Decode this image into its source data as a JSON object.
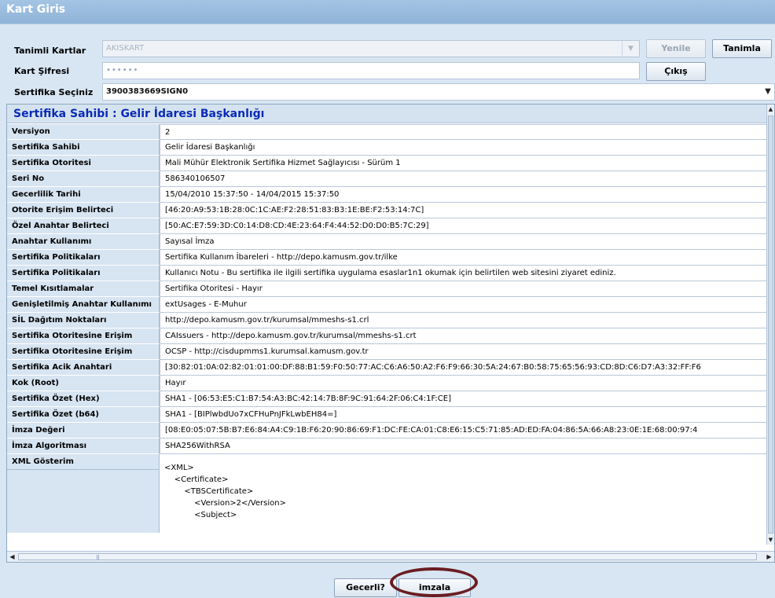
{
  "window": {
    "title": "Kart Giris"
  },
  "form": {
    "card_label": "Tanimli Kartlar",
    "card_value": "AKISKART",
    "refresh_label": "Yenile",
    "define_label": "Tanimla",
    "pin_label": "Kart Şifresi",
    "pin_value": "••••••",
    "exit_label": "Çıkış",
    "cert_label": "Sertifika Seçiniz",
    "cert_value": "3900383669SIGN0"
  },
  "panel": {
    "title": "Sertifika Sahibi : Gelir İdaresi Başkanlığı",
    "rows": [
      {
        "key": "Versiyon",
        "value": "2"
      },
      {
        "key": "Sertifika Sahibi",
        "value": "Gelir İdaresi Başkanlığı"
      },
      {
        "key": "Sertifika Otoritesi",
        "value": "Mali Mühür Elektronik Sertifika Hizmet Sağlayıcısı - Sürüm 1"
      },
      {
        "key": "Seri No",
        "value": "586340106507"
      },
      {
        "key": "Gecerlilik Tarihi",
        "value": "15/04/2010 15:37:50 - 14/04/2015 15:37:50"
      },
      {
        "key": "Otorite Erişim Belirteci",
        "value": "[46:20:A9:53:1B:28:0C:1C:AE:F2:28:51:83:B3:1E:BE:F2:53:14:7C]"
      },
      {
        "key": "Özel Anahtar Belirteci",
        "value": "[50:AC:E7:59:3D:C0:14:D8:CD:4E:23:64:F4:44:52:D0:D0:B5:7C:29]"
      },
      {
        "key": "Anahtar Kullanımı",
        "value": "Sayısal İmza"
      },
      {
        "key": "Sertifika Politikaları",
        "value": "Sertifika Kullanım İbareleri - http://depo.kamusm.gov.tr/ilke"
      },
      {
        "key": "Sertifika Politikaları",
        "value": "Kullanıcı Notu - Bu sertifika ile ilgili sertifika uygulama esaslar1n1 okumak için belirtilen web sitesini ziyaret ediniz."
      },
      {
        "key": "Temel Kısıtlamalar",
        "value": "Sertifika Otoritesi - Hayır"
      },
      {
        "key": "Genişletilmiş Anahtar Kullanımı",
        "value": "extUsages - E-Muhur"
      },
      {
        "key": "SİL Dağıtım Noktaları",
        "value": " http://depo.kamusm.gov.tr/kurumsal/mmeshs-s1.crl"
      },
      {
        "key": "Sertifika Otoritesine Erişim",
        "value": "CAIssuers - http://depo.kamusm.gov.tr/kurumsal/mmeshs-s1.crt"
      },
      {
        "key": "Sertifika Otoritesine Erişim",
        "value": "OCSP - http://cisdupmms1.kurumsal.kamusm.gov.tr"
      },
      {
        "key": "Sertifika Acik Anahtari",
        "value": "[30:82:01:0A:02:82:01:01:00:DF:88:B1:59:F0:50:77:AC:C6:A6:50:A2:F6:F9:66:30:5A:24:67:B0:58:75:65:56:93:CD:8D:C6:D7:A3:32:FF:F6"
      },
      {
        "key": "Kok (Root)",
        "value": "Hayır"
      },
      {
        "key": "Sertifika Özet (Hex)",
        "value": "SHA1 - [06:53:E5:C1:B7:54:A3:BC:42:14:7B:8F:9C:91:64:2F:06:C4:1F:CE]"
      },
      {
        "key": "Sertifika Özet (b64)",
        "value": "SHA1 - [BIPlwbdUo7xCFHuPnJFkLwbEH84=]"
      },
      {
        "key": "İmza Değeri",
        "value": "[08:E0:05:07:5B:B7:E6:84:A4:C9:1B:F6:20:90:86:69:F1:DC:FE:CA:01:C8:E6:15:C5:71:85:AD:ED:FA:04:86:5A:66:A8:23:0E:1E:68:00:97:4"
      },
      {
        "key": "İmza Algoritması",
        "value": "SHA256WithRSA"
      }
    ],
    "xml_label": "XML Gösterim",
    "xml_text": "<XML>\n    <Certificate>\n        <TBSCertificate>\n            <Version>2</Version>\n            <Subject>"
  },
  "footer": {
    "valid_label": "Gecerli?",
    "sign_label": "imzala"
  }
}
